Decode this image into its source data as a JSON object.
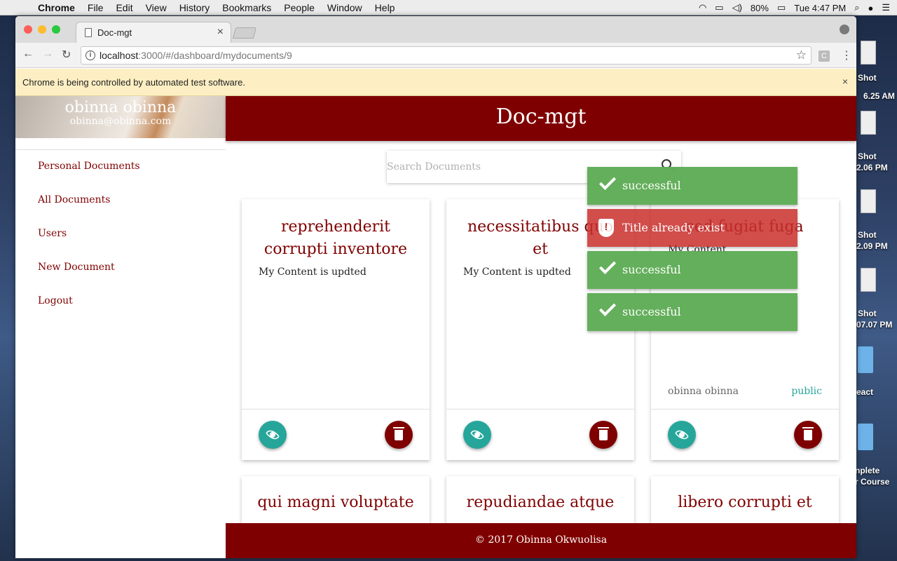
{
  "menubar": {
    "app": "Chrome",
    "items": [
      "File",
      "Edit",
      "View",
      "History",
      "Bookmarks",
      "People",
      "Window",
      "Help"
    ],
    "battery": "80%",
    "clock": "Tue 4:47 PM"
  },
  "desktop": {
    "labels": [
      "Shot",
      "6.25 AM",
      "Shot",
      "2.06 PM",
      "Shot",
      "2.09 PM",
      "Shot",
      "07.07 PM",
      "eact",
      "nplete",
      "r Course"
    ]
  },
  "browser": {
    "tab_title": "Doc-mgt",
    "url_host": "localhost",
    "url_path": ":3000/#/dashboard/mydocuments/9",
    "ext_label": "C",
    "infobar_message": "Chrome is being controlled by automated test software."
  },
  "sidebar": {
    "user_name": "obinna obinna",
    "user_email": "obinna@obinna.com",
    "links": [
      "Personal Documents",
      "All Documents",
      "Users",
      "New Document",
      "Logout"
    ]
  },
  "header": {
    "title": "Doc-mgt"
  },
  "search": {
    "placeholder": "Search Documents"
  },
  "cards": [
    {
      "title": "reprehenderit corrupti inventore",
      "content": "My Content is updted"
    },
    {
      "title": "necessitatibus quo et",
      "content": "My Content is updted"
    },
    {
      "title": "sed fugiat fuga",
      "content": "My Content",
      "author": "obinna obinna",
      "access": "public"
    },
    {
      "title": "qui magni voluptate"
    },
    {
      "title": "repudiandae atque"
    },
    {
      "title": "libero corrupti et"
    }
  ],
  "toasts": [
    {
      "text": "successful",
      "type": "success"
    },
    {
      "text": "Title already exist",
      "type": "error"
    },
    {
      "text": "successful",
      "type": "success"
    },
    {
      "text": "successful",
      "type": "success"
    }
  ],
  "footer": {
    "text": "© 2017 Obinna Okwuolisa"
  },
  "colors": {
    "brand": "#7f0000",
    "accent": "#26a69a",
    "success": "#5fad56",
    "error": "#c9302c"
  }
}
